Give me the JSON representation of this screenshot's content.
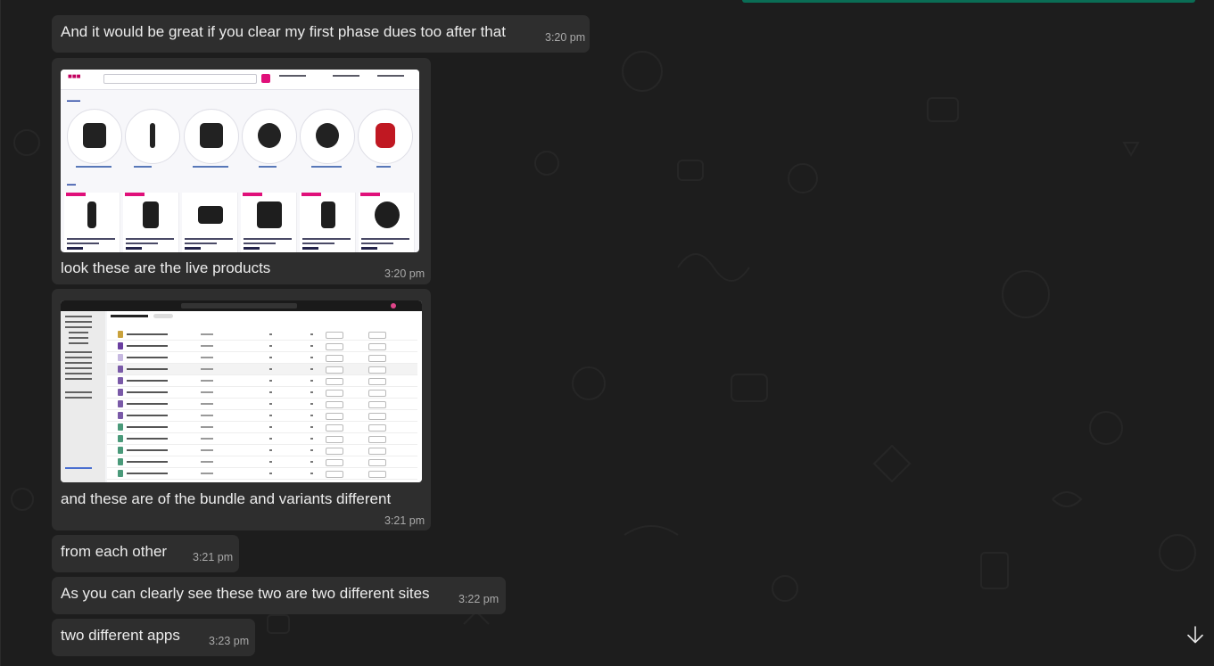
{
  "messages": [
    {
      "text": "And it would be great if you clear my first phase dues too after that",
      "time": "3:20 pm"
    },
    {
      "text": "look these are  the live products",
      "time": "3:20 pm",
      "image": "store-website-screenshot"
    },
    {
      "text": "and these are of the bundle and variants different",
      "time": "3:21 pm",
      "image": "admin-inventory-screenshot"
    },
    {
      "text": "from each other",
      "time": "3:21 pm"
    },
    {
      "text": "As you can clearly see these two are two different sites",
      "time": "3:22 pm"
    },
    {
      "text": "two different apps",
      "time": "3:23 pm"
    }
  ],
  "theme": {
    "background": "#1d1d1d",
    "bubble": "#2e2e2e",
    "text": "#ececec",
    "timestamp": "#a9a9a9",
    "accent": "#0a6d55"
  },
  "icons": {
    "scroll_down": "arrow-down-icon"
  }
}
